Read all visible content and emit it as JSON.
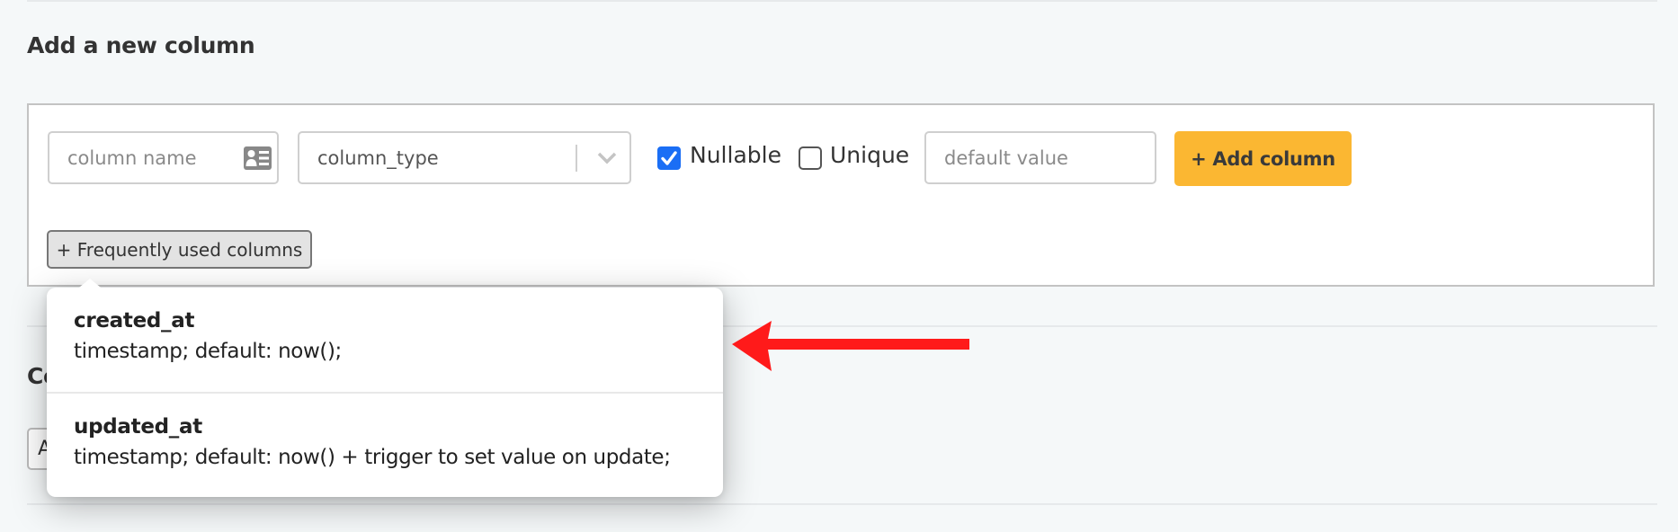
{
  "section_add": {
    "title": "Add a new column",
    "column_name": {
      "placeholder": "column name",
      "value": "",
      "icon": "contact-card-icon"
    },
    "column_type": {
      "placeholder": "column_type",
      "icon": "chevron-down-icon"
    },
    "nullable": {
      "label": "Nullable",
      "checked": true
    },
    "unique": {
      "label": "Unique",
      "checked": false
    },
    "default_value": {
      "placeholder": "default value",
      "value": ""
    },
    "add_button": {
      "label": "+ Add column",
      "color": "#fbb732"
    },
    "frequent_button": {
      "label": "+ Frequently used columns"
    }
  },
  "popover": {
    "items": [
      {
        "name": "created_at",
        "description": "timestamp; default: now();"
      },
      {
        "name": "updated_at",
        "description": "timestamp; default: now() + trigger to set value on update;"
      }
    ]
  },
  "section_next": {
    "title_partial": "Co",
    "button_partial": "A"
  },
  "annotation": {
    "type": "red-arrow",
    "color": "#ff1a1a",
    "points_to": "popover"
  },
  "colors": {
    "accent": "#fbb732",
    "checkbox": "#1a6ef5",
    "background": "#f5f8f9"
  }
}
